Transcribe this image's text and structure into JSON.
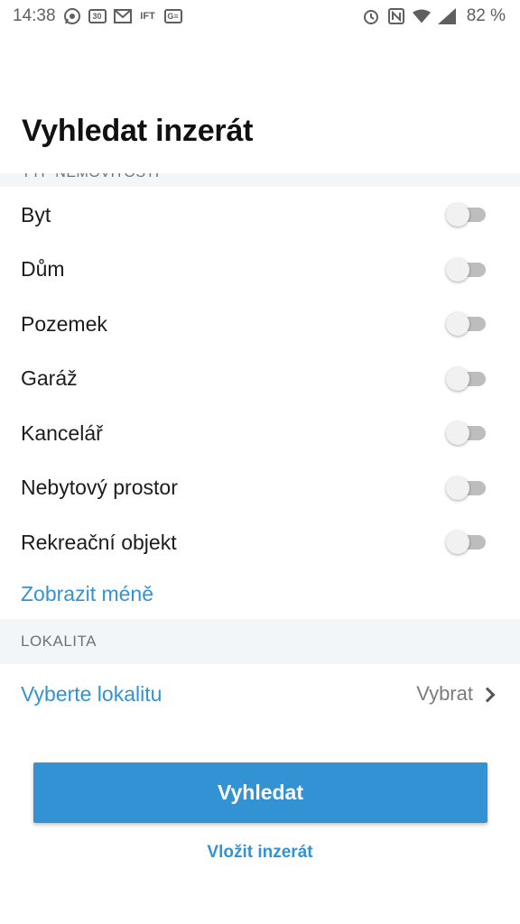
{
  "status_bar": {
    "time": "14:38",
    "left_icons": [
      "whatsapp-icon",
      "calendar-icon",
      "gmail-icon",
      "ift-app-icon",
      "ge-app-icon"
    ],
    "calendar_day": "30",
    "ift_text": "IFT",
    "ge_text": "G≡",
    "right_icons": [
      "alarm-icon",
      "nfc-icon",
      "wifi-icon",
      "cell-signal-icon"
    ],
    "battery": "82 %"
  },
  "page_title": "Vyhledat inzerát",
  "property_types": [
    {
      "label": "Byt",
      "enabled": false
    },
    {
      "label": "Dům",
      "enabled": false
    },
    {
      "label": "Pozemek",
      "enabled": false
    },
    {
      "label": "Garáž",
      "enabled": false
    },
    {
      "label": "Kancelář",
      "enabled": false
    },
    {
      "label": "Nebytový prostor",
      "enabled": false
    },
    {
      "label": "Rekreační objekt",
      "enabled": false
    }
  ],
  "show_less": "Zobrazit méně",
  "locality_section": {
    "header": "LOKALITA",
    "label": "Vyberte lokalitu",
    "choose": "Vybrat"
  },
  "search_button": "Vyhledat",
  "insert_link": "Vložit inzerát",
  "colors": {
    "accent": "#3392d3",
    "section_bg": "#f3f6f9",
    "toggle_off_track": "#bdbdbd"
  }
}
